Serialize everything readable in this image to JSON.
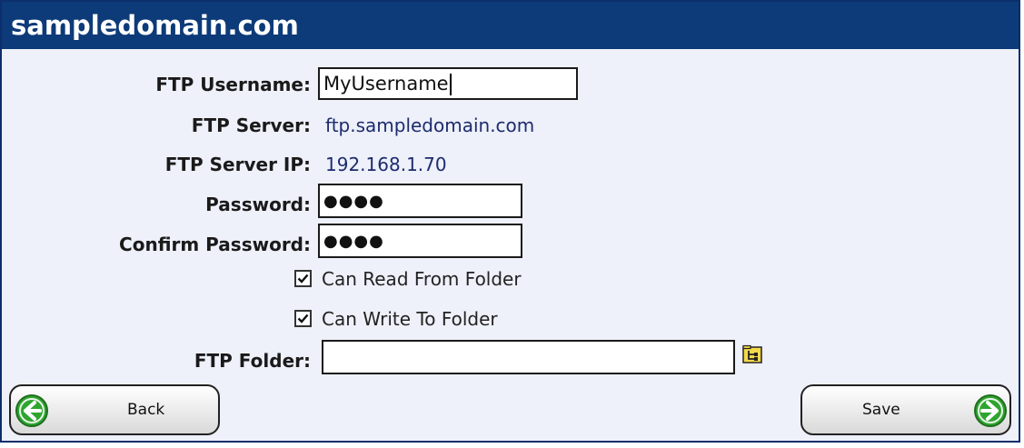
{
  "window": {
    "title": "sampledomain.com"
  },
  "form": {
    "ftp_username_label": "FTP Username:",
    "ftp_username_value": "MyUsername",
    "ftp_server_label": "FTP Server:",
    "ftp_server_value": "ftp.sampledomain.com",
    "ftp_server_ip_label": "FTP Server IP:",
    "ftp_server_ip_value": "192.168.1.70",
    "password_label": "Password:",
    "password_value": "●●●●",
    "confirm_password_label": "Confirm Password:",
    "confirm_password_value": "●●●●",
    "can_read_label": "Can Read From Folder",
    "can_read_checked": true,
    "can_write_label": "Can Write To Folder",
    "can_write_checked": true,
    "ftp_folder_label": "FTP Folder:",
    "ftp_folder_value": ""
  },
  "buttons": {
    "back_label": "Back",
    "save_label": "Save"
  },
  "icons": {
    "folder_browse": "folder-browse-icon",
    "back_arrow": "arrow-left-icon",
    "save_arrow": "arrow-right-icon"
  },
  "colors": {
    "title_bar": "#0d3a78",
    "panel_bg": "#eef0fa",
    "value_text": "#1c2c6c",
    "arrow_green": "#2fa52f"
  }
}
